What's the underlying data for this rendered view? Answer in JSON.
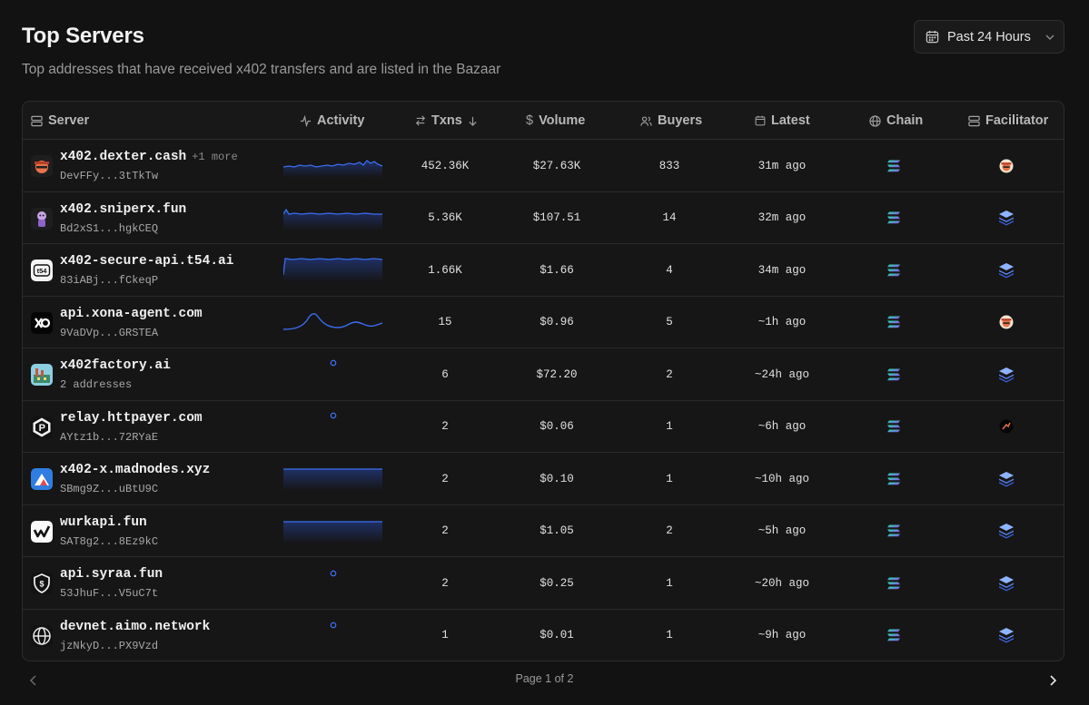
{
  "header": {
    "title": "Top Servers",
    "subtitle": "Top addresses that have received x402 transfers and are listed in the Bazaar"
  },
  "time_range": {
    "selected": "Past 24 Hours"
  },
  "table": {
    "columns": {
      "server": "Server",
      "activity": "Activity",
      "txns": "Txns",
      "volume": "Volume",
      "buyers": "Buyers",
      "latest": "Latest",
      "chain": "Chain",
      "facilitator": "Facilitator"
    },
    "rows": [
      {
        "name": "x402.dexter.cash",
        "more": "+1 more",
        "address": "DevFFy...3tTkTw",
        "txns": "452.36K",
        "volume": "$27.63K",
        "buyers": "833",
        "latest": "31m ago",
        "facilitator": "dexter-facilitator-icon"
      },
      {
        "name": "x402.sniperx.fun",
        "more": "",
        "address": "Bd2xS1...hgkCEQ",
        "txns": "5.36K",
        "volume": "$107.51",
        "buyers": "14",
        "latest": "32m ago",
        "facilitator": "stack-facilitator-icon"
      },
      {
        "name": "x402-secure-api.t54.ai",
        "more": "",
        "address": "83iABj...fCkeqP",
        "txns": "1.66K",
        "volume": "$1.66",
        "buyers": "4",
        "latest": "34m ago",
        "facilitator": "stack-facilitator-icon"
      },
      {
        "name": "api.xona-agent.com",
        "more": "",
        "address": "9VaDVp...GRSTEA",
        "txns": "15",
        "volume": "$0.96",
        "buyers": "5",
        "latest": "~1h ago",
        "facilitator": "dexter-facilitator-icon"
      },
      {
        "name": "x402factory.ai",
        "more": "",
        "address": "2 addresses",
        "txns": "6",
        "volume": "$72.20",
        "buyers": "2",
        "latest": "~24h ago",
        "facilitator": "stack-facilitator-icon"
      },
      {
        "name": "relay.httpayer.com",
        "more": "",
        "address": "AYtz1b...72RYaE",
        "txns": "2",
        "volume": "$0.06",
        "buyers": "1",
        "latest": "~6h ago",
        "facilitator": "dark-facilitator-icon"
      },
      {
        "name": "x402-x.madnodes.xyz",
        "more": "",
        "address": "SBmg9Z...uBtU9C",
        "txns": "2",
        "volume": "$0.10",
        "buyers": "1",
        "latest": "~10h ago",
        "facilitator": "stack-facilitator-icon"
      },
      {
        "name": "wurkapi.fun",
        "more": "",
        "address": "SAT8g2...8Ez9kC",
        "txns": "2",
        "volume": "$1.05",
        "buyers": "2",
        "latest": "~5h ago",
        "facilitator": "stack-facilitator-icon"
      },
      {
        "name": "api.syraa.fun",
        "more": "",
        "address": "53JhuF...V5uC7t",
        "txns": "2",
        "volume": "$0.25",
        "buyers": "1",
        "latest": "~20h ago",
        "facilitator": "stack-facilitator-icon"
      },
      {
        "name": "devnet.aimo.network",
        "more": "",
        "address": "jzNkyD...PX9Vzd",
        "txns": "1",
        "volume": "$0.01",
        "buyers": "1",
        "latest": "~9h ago",
        "facilitator": "stack-facilitator-icon"
      }
    ]
  },
  "pagination": {
    "label": "Page 1 of 2"
  },
  "colors": {
    "accent": "#3b6df0",
    "solana_top": "#14f195",
    "solana_bottom": "#9945ff"
  }
}
